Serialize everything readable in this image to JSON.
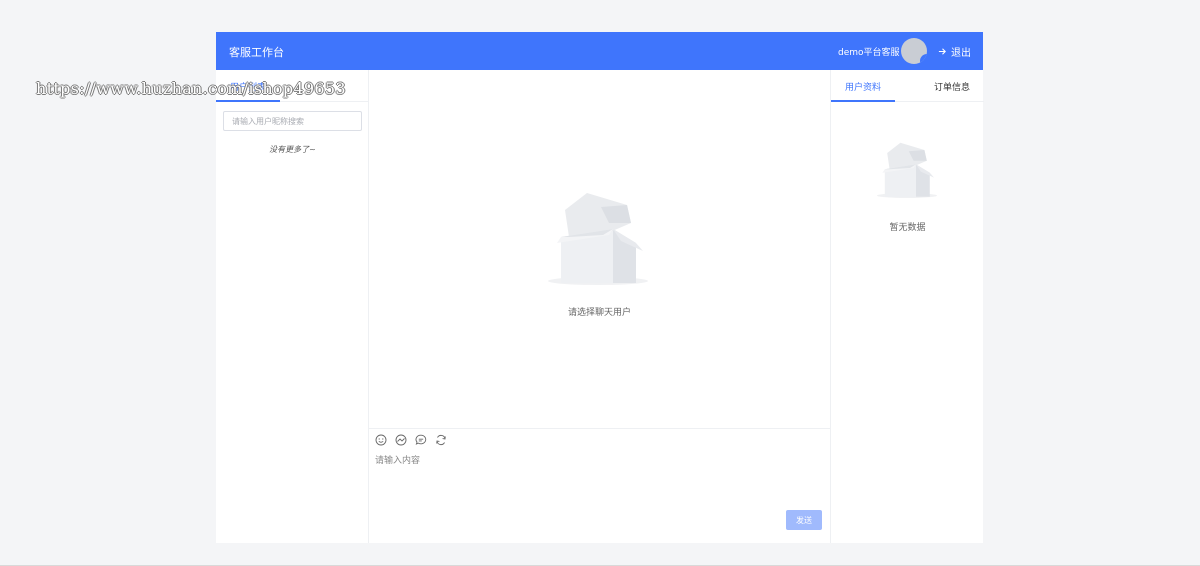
{
  "header": {
    "title": "客服工作台",
    "user_name": "demo平台客服",
    "logout_label": "退出"
  },
  "left": {
    "tab_label": "用户列表",
    "search_placeholder": "请输入用户昵称搜索",
    "no_more_text": "没有更多了~"
  },
  "center": {
    "empty_text": "请选择聊天用户",
    "toolbar_icons": [
      "emoji-icon",
      "image-icon",
      "quick-reply-icon",
      "refresh-icon"
    ],
    "message_placeholder": "请输入内容",
    "send_label": "发送"
  },
  "right": {
    "tabs": [
      {
        "label": "用户资料"
      },
      {
        "label": "订单信息"
      }
    ],
    "empty_text": "暂无数据"
  },
  "watermark": "https://www.huzhan.com/ishop49653",
  "colors": {
    "primary": "#3f75fc",
    "send_disabled": "#a0bafd",
    "page_bg": "#f4f5f7"
  }
}
